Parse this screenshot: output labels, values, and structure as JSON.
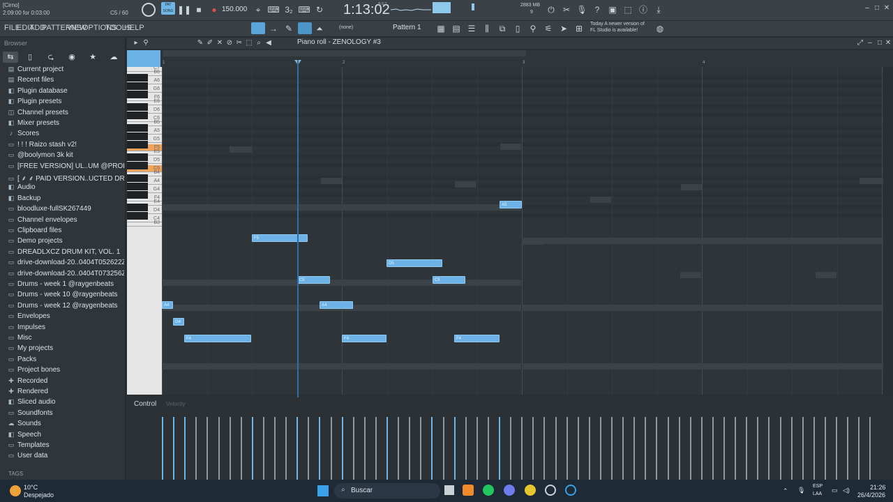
{
  "topbar": {
    "hint_line1": "[Cirno]",
    "hint_line2": "2:09:00 for 0:03:00",
    "poly": "C5 / 60",
    "pat_song": "PAT SONG",
    "tempo": "150.000",
    "time": "1:13:02",
    "time_sub": "B:S:T",
    "cpu": "2883 MB",
    "cpu_sub": "9"
  },
  "menu": {
    "items": [
      "FILE",
      "EDIT",
      "ADD",
      "PATTERNS",
      "VIEW",
      "OPTIONS",
      "TOOLS",
      "HELP"
    ],
    "none_label": "(none)",
    "pattern_label": "Pattern 1",
    "news_line1": "Today  A newer version of",
    "news_line2": "FL Studio is available!"
  },
  "browser": {
    "title": "Browser",
    "items": [
      {
        "icon": "project-icon",
        "glyph": "▤",
        "label": "Current project"
      },
      {
        "icon": "recent-icon",
        "glyph": "▤",
        "label": "Recent files"
      },
      {
        "icon": "plugin-db-icon",
        "glyph": "◧",
        "label": "Plugin database"
      },
      {
        "icon": "plugin-presets-icon",
        "glyph": "◧",
        "label": "Plugin presets"
      },
      {
        "icon": "channel-presets-icon",
        "glyph": "◫",
        "label": "Channel presets"
      },
      {
        "icon": "mixer-presets-icon",
        "glyph": "◧",
        "label": "Mixer presets"
      },
      {
        "icon": "scores-icon",
        "glyph": "♪",
        "label": "Scores"
      },
      {
        "icon": "folder-icon",
        "glyph": "▭",
        "label": "! ! ! Raizo stash v2!"
      },
      {
        "icon": "folder-icon",
        "glyph": "▭",
        "label": "@boolymon 3k kit"
      },
      {
        "icon": "folder-icon",
        "glyph": "▭",
        "label": "[FREE VERSION] UL..UM @PROD.ROSEYY$"
      },
      {
        "icon": "folder-icon",
        "glyph": "▭",
        "label": "[ ⸙ ⸙ PAID VERSION..UCTED DRUM KIT"
      },
      {
        "icon": "audio-icon",
        "glyph": "◧",
        "label": "Audio"
      },
      {
        "icon": "backup-icon",
        "glyph": "◧",
        "label": "Backup"
      },
      {
        "icon": "folder-icon",
        "glyph": "▭",
        "label": "bloodluxe-fullSK267449"
      },
      {
        "icon": "folder-icon",
        "glyph": "▭",
        "label": "Channel envelopes"
      },
      {
        "icon": "folder-icon",
        "glyph": "▭",
        "label": "Clipboard files"
      },
      {
        "icon": "folder-icon",
        "glyph": "▭",
        "label": "Demo projects"
      },
      {
        "icon": "folder-icon",
        "glyph": "▭",
        "label": "DREADLXCZ DRUM KIT, VOL. 1"
      },
      {
        "icon": "folder-icon",
        "glyph": "▭",
        "label": "drive-download-20..0404T052622Z-1-001"
      },
      {
        "icon": "folder-icon",
        "glyph": "▭",
        "label": "drive-download-20..0404T073256Z-1-001"
      },
      {
        "icon": "folder-icon",
        "glyph": "▭",
        "label": "Drums - week 1 @raygenbeats"
      },
      {
        "icon": "folder-icon",
        "glyph": "▭",
        "label": "Drums - week 10 @raygenbeats"
      },
      {
        "icon": "folder-icon",
        "glyph": "▭",
        "label": "Drums - week 12 @raygenbeats"
      },
      {
        "icon": "folder-icon",
        "glyph": "▭",
        "label": "Envelopes"
      },
      {
        "icon": "folder-icon",
        "glyph": "▭",
        "label": "Impulses"
      },
      {
        "icon": "folder-icon",
        "glyph": "▭",
        "label": "Misc"
      },
      {
        "icon": "folder-icon",
        "glyph": "▭",
        "label": "My projects"
      },
      {
        "icon": "folder-icon",
        "glyph": "▭",
        "label": "Packs"
      },
      {
        "icon": "folder-icon",
        "glyph": "▭",
        "label": "Project bones"
      },
      {
        "icon": "recorded-icon",
        "glyph": "✚",
        "label": "Recorded"
      },
      {
        "icon": "rendered-icon",
        "glyph": "✚",
        "label": "Rendered"
      },
      {
        "icon": "sliced-icon",
        "glyph": "◧",
        "label": "Sliced audio"
      },
      {
        "icon": "soundfonts-icon",
        "glyph": "▭",
        "label": "Soundfonts"
      },
      {
        "icon": "sounds-icon",
        "glyph": "☁",
        "label": "Sounds"
      },
      {
        "icon": "speech-icon",
        "glyph": "◧",
        "label": "Speech"
      },
      {
        "icon": "templates-icon",
        "glyph": "▭",
        "label": "Templates"
      },
      {
        "icon": "folder-icon",
        "glyph": "▭",
        "label": "User data"
      }
    ],
    "tags": "TAGS"
  },
  "piano_roll": {
    "title": "Piano roll - ZENOLOGY #3",
    "ruler_marks": [
      "1",
      "2",
      "3",
      "4"
    ],
    "control_label": "Control",
    "control_sub": "Velocity",
    "key_labels": [
      "C7",
      "B6",
      "A6",
      "G6",
      "F6",
      "E6",
      "D6",
      "C6",
      "B5",
      "A5",
      "G5",
      "F5",
      "E5",
      "D5",
      "C5",
      "B4",
      "A4",
      "G4",
      "F4",
      "E4",
      "D4",
      "C4",
      "B3"
    ]
  },
  "taskbar": {
    "temp": "10°C",
    "weather": "Despejado",
    "search": "Buscar",
    "lang1": "ESP",
    "lang2": "LAA",
    "time": "21:26",
    "date": "26/4/2026"
  },
  "colors": {
    "note": "#6cb2e6",
    "accent": "#e89a50"
  }
}
